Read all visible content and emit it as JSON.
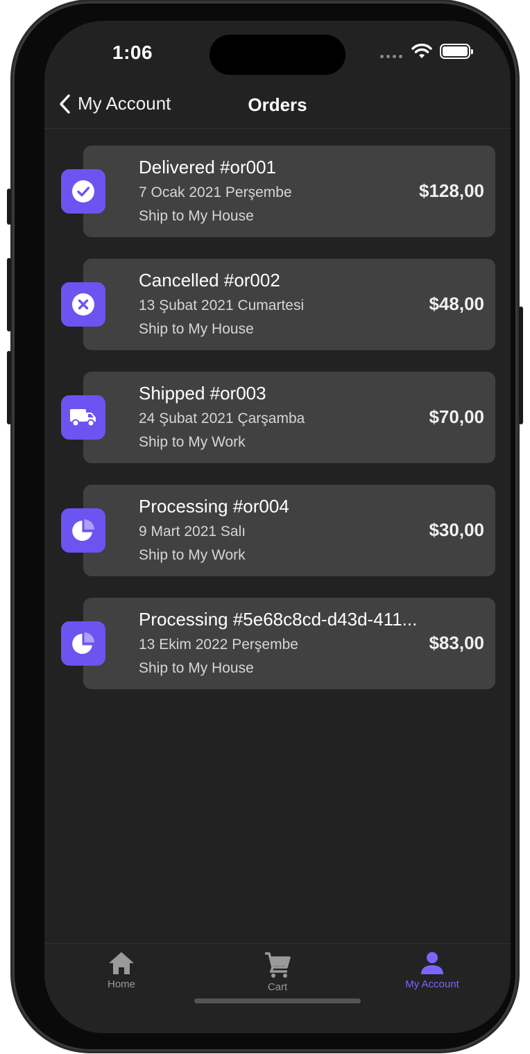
{
  "status_bar": {
    "time": "1:06"
  },
  "navbar": {
    "back_label": "My Account",
    "title": "Orders"
  },
  "orders": [
    {
      "status": "delivered",
      "title": "Delivered #or001",
      "date": "7 Ocak 2021 Perşembe",
      "ship_to": "Ship to My House",
      "price": "$128,00",
      "icon": "check-circle-icon"
    },
    {
      "status": "cancelled",
      "title": "Cancelled #or002",
      "date": "13 Şubat 2021 Cumartesi",
      "ship_to": "Ship to My House",
      "price": "$48,00",
      "icon": "x-circle-icon"
    },
    {
      "status": "shipped",
      "title": "Shipped #or003",
      "date": "24 Şubat 2021 Çarşamba",
      "ship_to": "Ship to My Work",
      "price": "$70,00",
      "icon": "truck-icon"
    },
    {
      "status": "processing",
      "title": "Processing #or004",
      "date": "9 Mart 2021 Salı",
      "ship_to": "Ship to My Work",
      "price": "$30,00",
      "icon": "pie-chart-icon"
    },
    {
      "status": "processing",
      "title": "Processing #5e68c8cd-d43d-411...",
      "date": "13 Ekim 2022 Perşembe",
      "ship_to": "Ship to My House",
      "price": "$83,00",
      "icon": "pie-chart-icon"
    }
  ],
  "tabbar": {
    "items": [
      {
        "label": "Home",
        "icon": "home-icon",
        "active": false
      },
      {
        "label": "Cart",
        "icon": "cart-icon",
        "active": false
      },
      {
        "label": "My Account",
        "icon": "person-icon",
        "active": true
      }
    ]
  },
  "colors": {
    "accent": "#6c54f0",
    "active_tab": "#7b66ff",
    "background": "#222222",
    "card": "#414141"
  }
}
